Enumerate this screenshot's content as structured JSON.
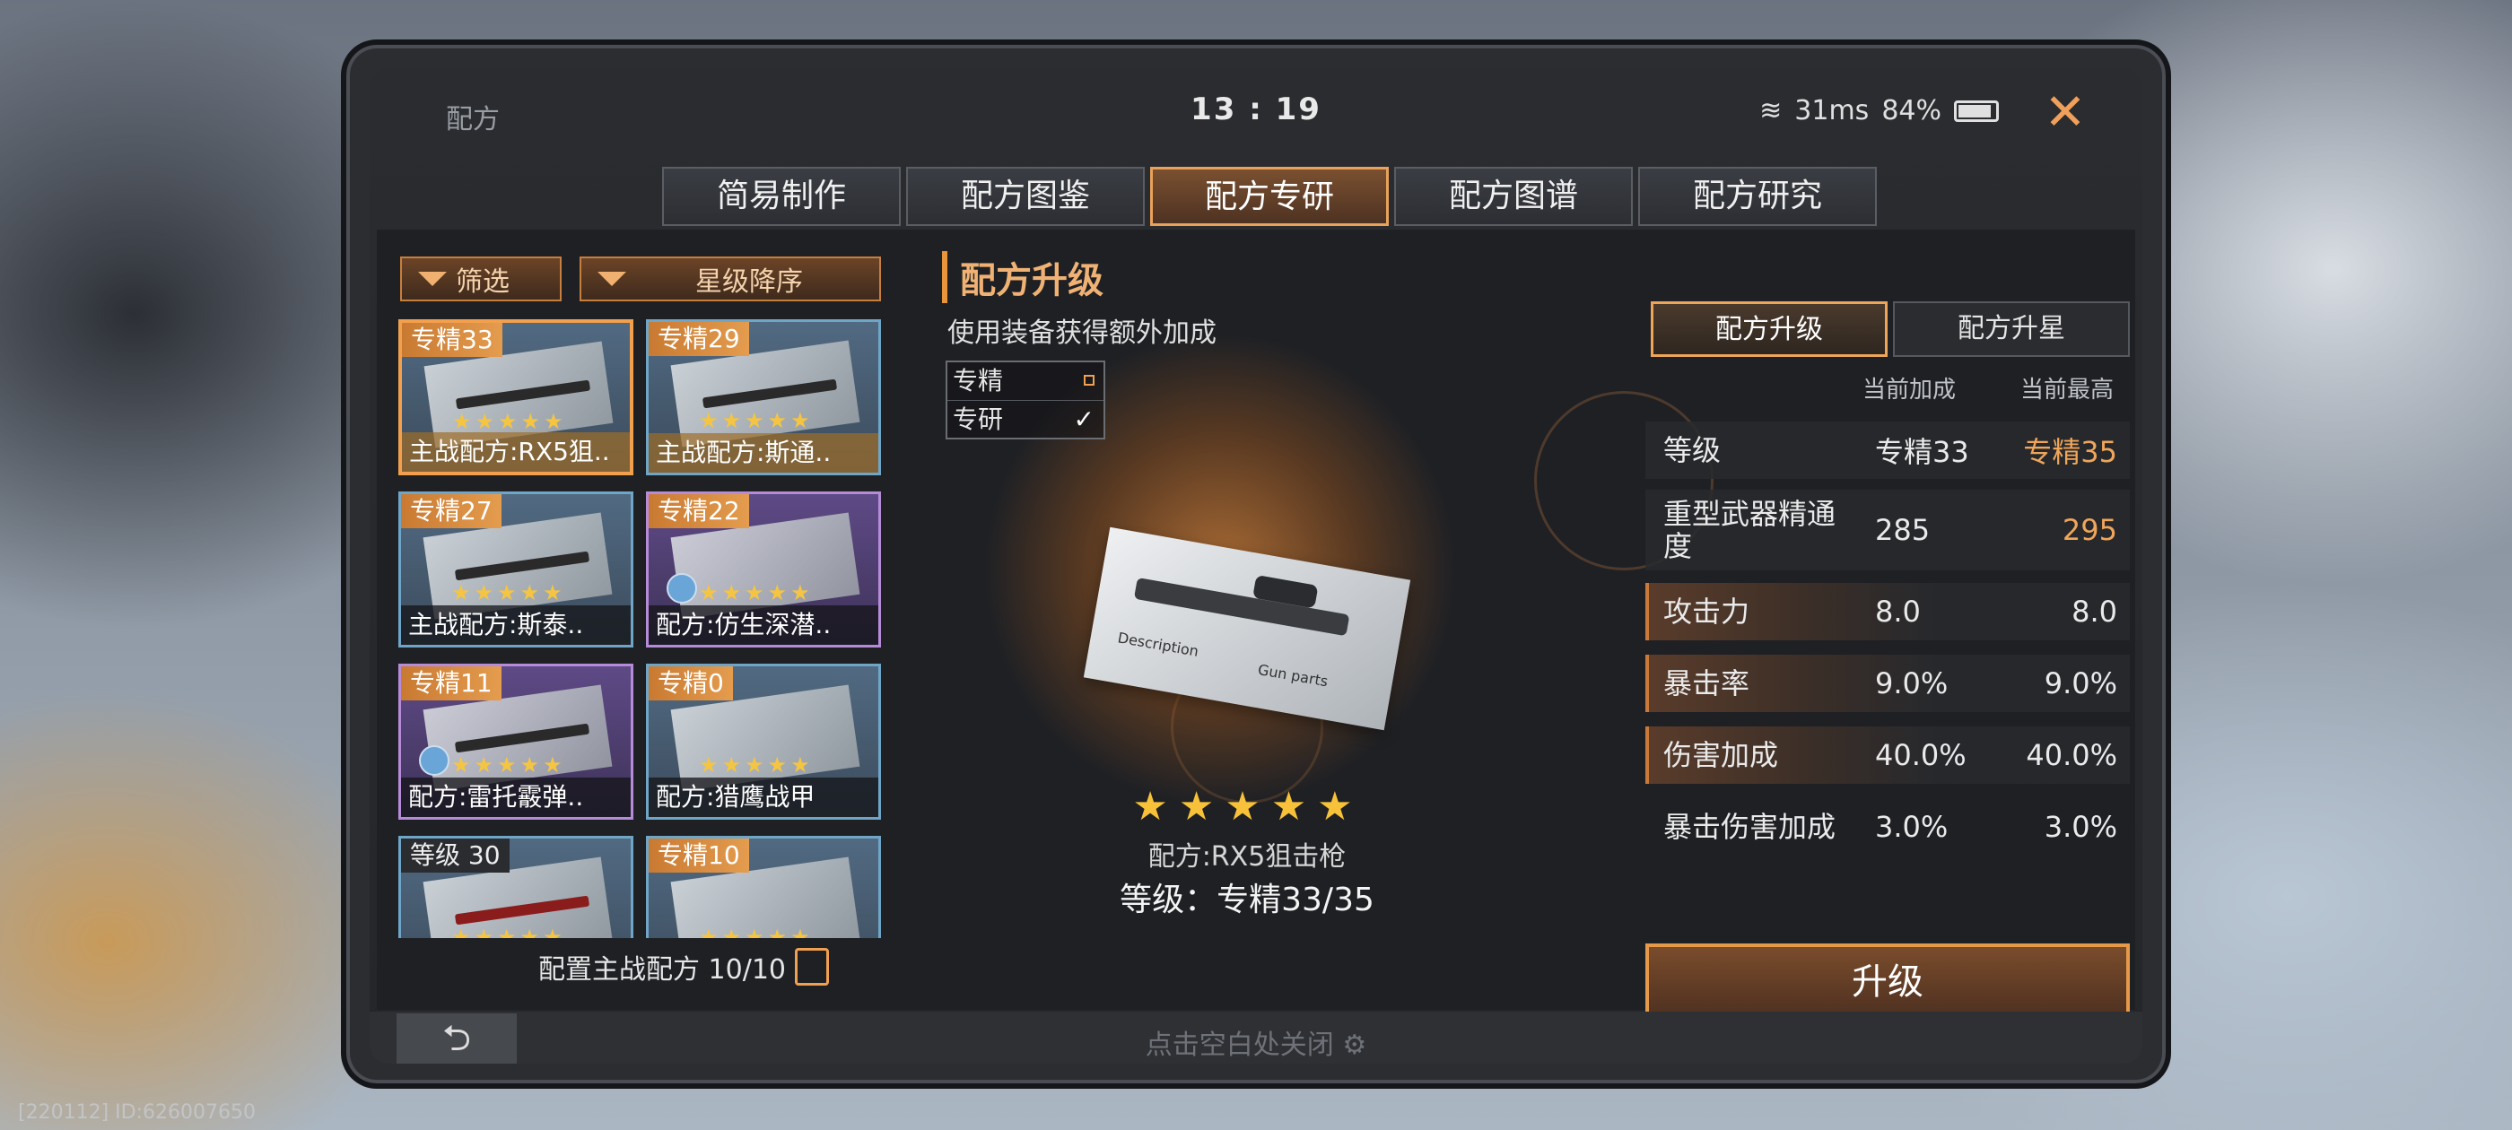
{
  "status": {
    "title": "配方",
    "time": "13 : 19",
    "ping": "31ms",
    "battery": "84%"
  },
  "tabs": [
    "简易制作",
    "配方图鉴",
    "配方专研",
    "配方图谱",
    "配方研究"
  ],
  "active_tab": 2,
  "filters": {
    "filter_label": "筛选",
    "sort_label": "星级降序"
  },
  "cards": [
    {
      "tag": "专精33",
      "name": "主战配方:RX5狙..",
      "stars": 5
    },
    {
      "tag": "专精29",
      "name": "主战配方:斯通..",
      "stars": 5
    },
    {
      "tag": "专精27",
      "name": "主战配方:斯泰..",
      "stars": 5
    },
    {
      "tag": "专精22",
      "name": "配方:仿生深潜..",
      "stars": 5
    },
    {
      "tag": "专精11",
      "name": "配方:雷托霰弹..",
      "stars": 5
    },
    {
      "tag": "专精0",
      "name": "配方:猎鹰战甲",
      "stars": 5
    },
    {
      "tag": "等级 30",
      "name": "",
      "stars": 5
    },
    {
      "tag": "专精10",
      "name": "",
      "stars": 5
    }
  ],
  "config_label": "配置主战配方 10/10",
  "middle": {
    "title": "配方升级",
    "subtitle": "使用装备获得额外加成",
    "legend": [
      {
        "label": "专精"
      },
      {
        "label": "专研"
      }
    ],
    "blueprint_text_1": "Description",
    "blueprint_text_2": "Gun parts",
    "item_name": "配方:RX5狙击枪",
    "item_level": "等级：专精33/35"
  },
  "right": {
    "tabs": [
      "配方升级",
      "配方升星"
    ],
    "col_current": "当前加成",
    "col_max": "当前最高",
    "stats": [
      {
        "label": "等级",
        "current": "专精33",
        "max": "专精35"
      },
      {
        "label": "重型武器精通度",
        "current": "285",
        "max": "295"
      },
      {
        "label": "攻击力",
        "current": "8.0",
        "max": "8.0"
      },
      {
        "label": "暴击率",
        "current": "9.0%",
        "max": "9.0%"
      },
      {
        "label": "伤害加成",
        "current": "40.0%",
        "max": "40.0%"
      },
      {
        "label": "暴击伤害加成",
        "current": "3.0%",
        "max": "3.0%"
      }
    ],
    "upgrade_label": "升级"
  },
  "close_hint": "点击空白处关闭",
  "footer_id": "[220112] ID:626007650",
  "colors": {
    "accent": "#e8953e",
    "highlight": "#f0a65a",
    "panel": "#24262a"
  }
}
